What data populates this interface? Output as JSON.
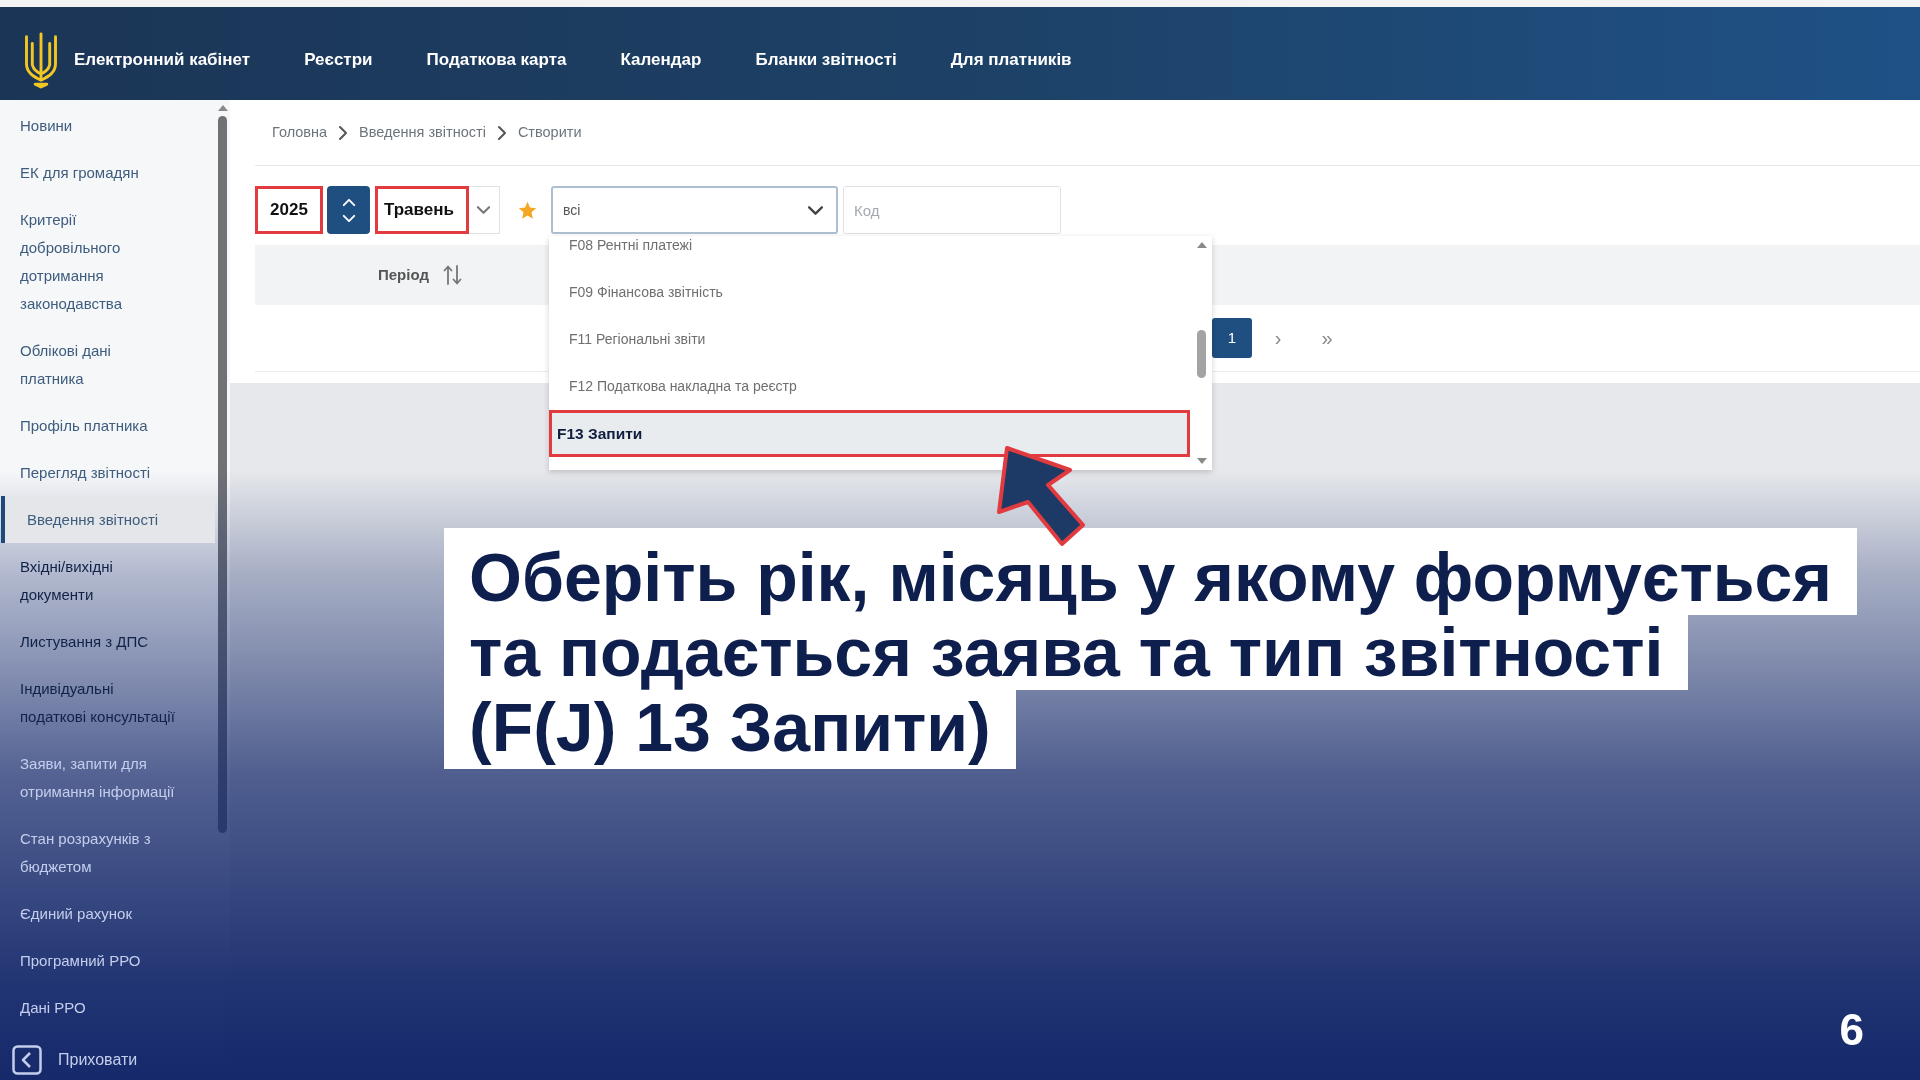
{
  "navbar": {
    "brand": "Електронний кабінет",
    "items": [
      {
        "label": "Реєстри"
      },
      {
        "label": "Податкова карта"
      },
      {
        "label": "Календар"
      },
      {
        "label": "Бланки звітності"
      },
      {
        "label": "Для платників"
      }
    ]
  },
  "sidebar": {
    "items": [
      {
        "label": "Новини",
        "selected": false
      },
      {
        "label": "ЕК для громадян",
        "selected": false
      },
      {
        "label": "Критерії добровільного дотримання законодавства",
        "selected": false
      },
      {
        "label": "Облікові дані платника",
        "selected": false
      },
      {
        "label": "Профіль платника",
        "selected": false
      },
      {
        "label": "Перегляд звітності",
        "selected": false
      },
      {
        "label": "Введення звітності",
        "selected": true
      },
      {
        "label": "Вхідні/вихідні документи",
        "selected": false
      },
      {
        "label": "Листування з ДПС",
        "selected": false
      },
      {
        "label": "Індивідуальні податкові консультації",
        "selected": false
      },
      {
        "label": "Заяви, запити для отримання інформації",
        "selected": false
      },
      {
        "label": "Стан розрахунків з бюджетом",
        "selected": false
      },
      {
        "label": "Єдиний рахунок",
        "selected": false
      },
      {
        "label": "Програмний РРО",
        "selected": false
      },
      {
        "label": "Дані РРО",
        "selected": false
      }
    ],
    "collapse_label": "Приховати"
  },
  "breadcrumb": [
    {
      "label": "Головна"
    },
    {
      "label": "Введення звітності"
    },
    {
      "label": "Створити"
    }
  ],
  "filters": {
    "year": {
      "value": "2025",
      "highlighted": true
    },
    "month": {
      "value": "Травень",
      "highlighted": true
    },
    "report_type": {
      "value": "всі"
    },
    "code": {
      "placeholder": "Код"
    }
  },
  "dropdown": {
    "options": [
      {
        "label": "F08 Рентні платежі",
        "selected": false,
        "highlighted": false
      },
      {
        "label": "F09 Фінансова звітність",
        "selected": false,
        "highlighted": false
      },
      {
        "label": "F11 Регіональні звіти",
        "selected": false,
        "highlighted": false
      },
      {
        "label": "F12 Податкова накладна та реєстр",
        "selected": false,
        "highlighted": false
      },
      {
        "label": "F13 Запити",
        "selected": true,
        "highlighted": true
      }
    ]
  },
  "table": {
    "columns": [
      {
        "label": "Період"
      }
    ]
  },
  "pagination": {
    "pages": [
      {
        "label": "1",
        "selected": true
      }
    ],
    "next": "›",
    "last": "»"
  },
  "caption": {
    "lines": [
      "Оберіть рік, місяць у якому формується",
      "та подається заява та тип звітності",
      "(F(J) 13 Запити)"
    ]
  },
  "slide_number": "6"
}
